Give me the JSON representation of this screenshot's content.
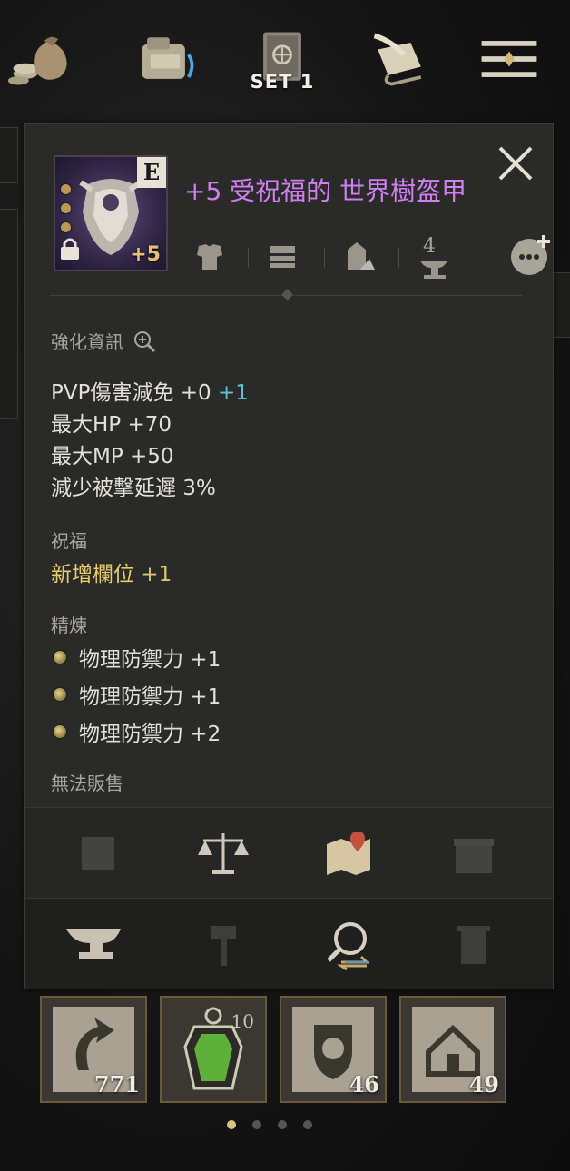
{
  "topbar": {
    "icons": [
      "money-bag-icon",
      "backpack-icon",
      "equipment-set-book-icon",
      "scroll-quill-icon",
      "menu-icon"
    ],
    "set_label": "SET 1"
  },
  "item": {
    "title": "+5 受祝福的 世界樹盔甲",
    "grade": "E",
    "enhance": "+5",
    "action_anvil_level": "4"
  },
  "sections": {
    "enhance_info_label": "強化資訊",
    "stats": [
      {
        "label": "PVP傷害減免 +0",
        "bonus": "+1"
      },
      {
        "label": "最大HP +70",
        "bonus": ""
      },
      {
        "label": "最大MP +50",
        "bonus": ""
      },
      {
        "label": "減少被擊延遲 3%",
        "bonus": ""
      }
    ],
    "blessing_label": "祝福",
    "blessing_stat": "新增欄位",
    "blessing_value": "+1",
    "refine_label": "精煉",
    "refine_stats": [
      "物理防禦力 +1",
      "物理防禦力 +1",
      "物理防禦力 +2"
    ],
    "cannot_sell": "無法販售"
  },
  "quickbar": {
    "slots": [
      {
        "icon": "return-scroll-icon",
        "count": "771",
        "top": ""
      },
      {
        "icon": "green-amulet-icon",
        "count": "",
        "top": "10"
      },
      {
        "icon": "lion-crest-scroll-icon",
        "count": "46",
        "top": ""
      },
      {
        "icon": "home-scroll-icon",
        "count": "49",
        "top": ""
      }
    ]
  },
  "colors": {
    "title": "#cf7ff0",
    "bonus": "#5fc0d8",
    "blessing": "#e6cc6a"
  }
}
